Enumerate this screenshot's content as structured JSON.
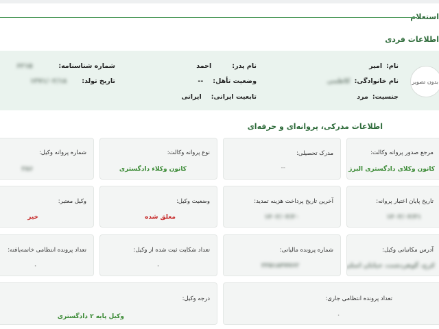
{
  "header": {
    "title": "استعلام"
  },
  "personal": {
    "section_title": "اطلاعات فردی",
    "avatar_text": "بدون تصویر",
    "name_label": "نام:",
    "name_value": "امیر",
    "father_label": "نام پدر:",
    "father_value": "احمد",
    "id_label": "شماره شناسنامه:",
    "id_value": "۶۲۱۵",
    "family_label": "نام خانوادگی:",
    "family_value": "کاظمی",
    "marital_label": "وضعیت تأهل:",
    "marital_value": "--",
    "birth_label": "تاریخ تولد:",
    "birth_value": "۱۳۷۱/۰۲/۱۸",
    "gender_label": "جنسیت:",
    "gender_value": "مرد",
    "nationality_label": "تابعیت ایرانی:",
    "nationality_value": "ایرانی"
  },
  "license": {
    "section_title": "اطلاعات مدرکی، پروانه‌ای و حرفه‌ای",
    "issuer_label": "مرجع صدور پروانه وکالت:",
    "issuer_value": "کانون وکلای دادگستری البرز",
    "degree_label": "مدرک تحصیلی:",
    "degree_value": "--",
    "type_label": "نوع پروانه وکالت:",
    "type_value": "کانون وکلاء دادگستری",
    "number_label": "شماره پروانه وکیل:",
    "number_value": "۲۸۶",
    "expiry_label": "تاریخ پایان اعتبار پروانه:",
    "expiry_value": "۱۴۰۳/۰۴/۳۱",
    "last_payment_label": "آخرین تاریخ پرداخت هزینه تمدید:",
    "last_payment_value": "۱۴۰۲/۰۴/۲۰",
    "status_label": "وضعیت وکیل:",
    "status_value": "معلق شده",
    "valid_label": "وکیل معتبر:",
    "valid_value": "خیر",
    "address_label": "آدرس مکاتباتی وکیل:",
    "address_value": "کرج، گوهردشت، خیابان اصلی",
    "tax_label": "شماره پرونده مالیاتی:",
    "tax_value": "۲۲۵۱۸۴۷۷۶۲",
    "complaints_label": "تعداد شکایت ثبت شده از وکیل:",
    "complaints_value": "۰",
    "closed_label": "تعداد پرونده انتظامی خاتمه‌یافته:",
    "closed_value": "۰",
    "current_label": "تعداد پرونده انتظامی جاری:",
    "current_value": "۰",
    "grade_label": "درجه وکیل:",
    "grade_value": "وکیل پایه ۲ دادگستری"
  }
}
